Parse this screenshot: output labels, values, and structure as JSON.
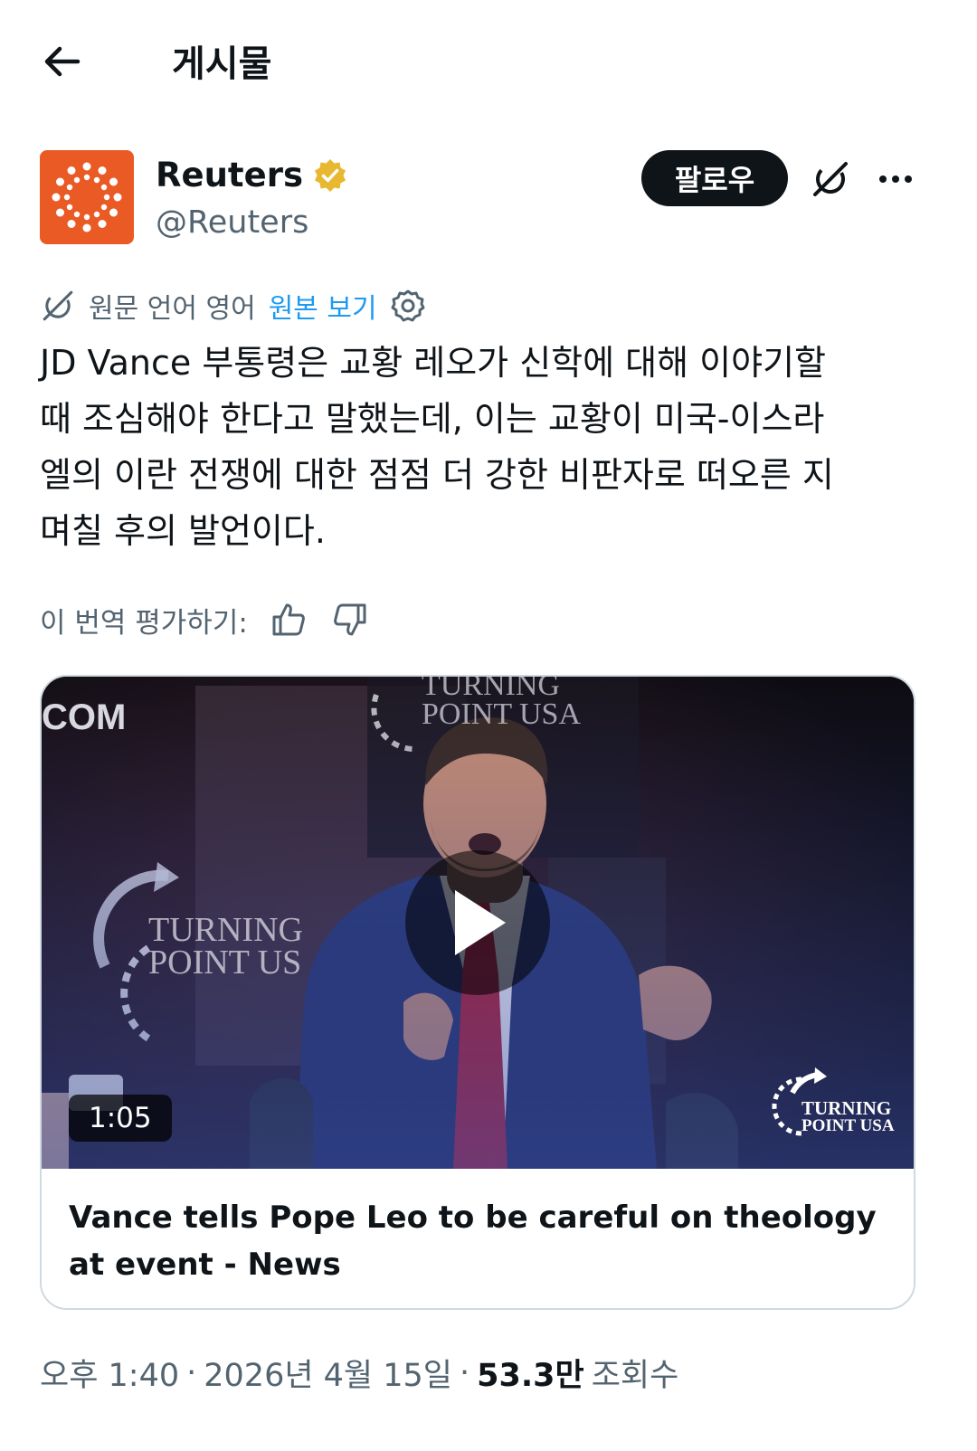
{
  "header": {
    "title": "게시물"
  },
  "author": {
    "name": "Reuters",
    "handle": "@Reuters",
    "verified": true,
    "avatar_color": "#ea5a24",
    "follow_label": "팔로우"
  },
  "translation": {
    "source_label": "원문 언어 영어",
    "show_original": "원본 보기"
  },
  "post": {
    "text": "JD Vance 부통령은 교황 레오가 신학에 대해 이야기할\n때 조심해야 한다고 말했는데, 이는 교황이 미국-이스라\n엘의 이란 전쟁에 대한 점점 더 강한 비판자로 떠오른 지\n며칠 후의 발언이다."
  },
  "rate": {
    "label": "이 번역 평가하기:"
  },
  "card": {
    "duration": "1:05",
    "title": "Vance tells Pope Leo to be careful on theology at event - News",
    "video_text": {
      "left": "COM",
      "top_banner_1": "TURNING",
      "top_banner_2": "POINT USA",
      "left_logo_1": "TURNING",
      "left_logo_2": "POINT US",
      "right_logo_1": "TURNING",
      "right_logo_2": "POINT USA"
    }
  },
  "meta": {
    "time": "오후 1:40",
    "sep1": "·",
    "date": "2026년 4월 15일",
    "sep2": "·",
    "views": "53.3만",
    "views_label": "조회수"
  },
  "colors": {
    "accent": "#1d9bf0",
    "text": "#0f1419",
    "muted": "#536471",
    "badge": "#e8b830"
  },
  "icons": [
    "back-arrow-icon",
    "verified-badge-icon",
    "grok-icon",
    "more-icon",
    "translate-icon",
    "settings-icon",
    "thumbs-up-icon",
    "thumbs-down-icon",
    "play-icon"
  ]
}
